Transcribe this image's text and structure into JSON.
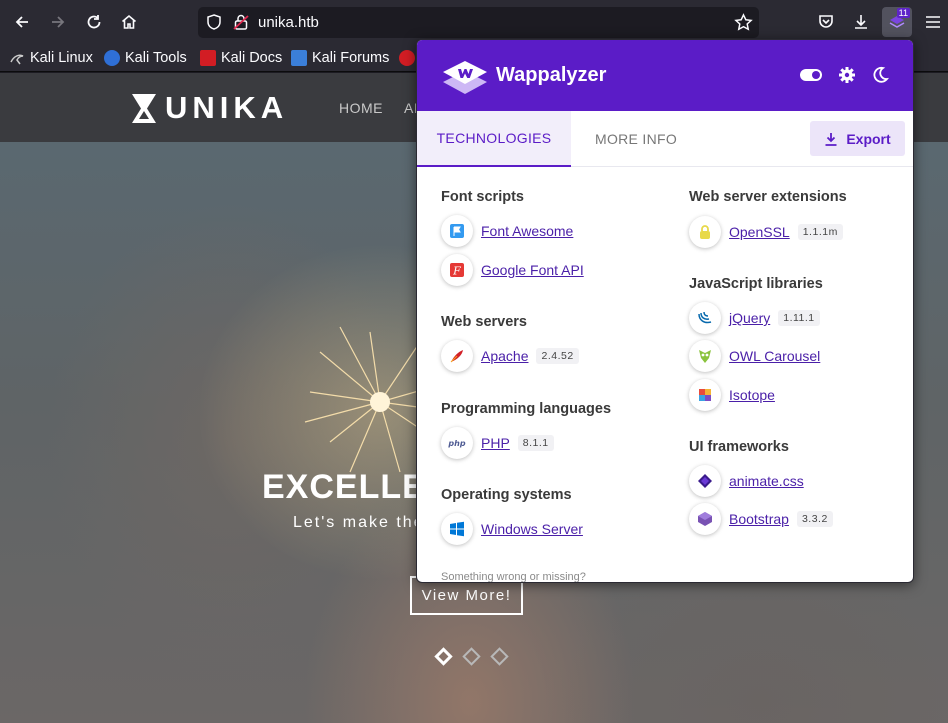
{
  "browser": {
    "url": "unika.htb",
    "extension_badge": "11",
    "bookmarks": [
      "Kali Linux",
      "Kali Tools",
      "Kali Docs",
      "Kali Forums"
    ]
  },
  "site": {
    "logo": "UNIKA",
    "nav": [
      "HOME",
      "AI"
    ],
    "hero_title": "EXCELLEN",
    "hero_subtitle": "Let's make the",
    "hero_button": "View More!"
  },
  "wappalyzer": {
    "brand": "Wappalyzer",
    "tabs": [
      "TECHNOLOGIES",
      "MORE INFO"
    ],
    "export_label": "Export",
    "footer": "Something wrong or missing?",
    "left_categories": [
      {
        "name": "Font scripts",
        "items": [
          {
            "name": "Font Awesome",
            "version": "",
            "icon": "font-awesome-icon"
          },
          {
            "name": "Google Font API",
            "version": "",
            "icon": "google-font-icon"
          }
        ]
      },
      {
        "name": "Web servers",
        "items": [
          {
            "name": "Apache",
            "version": "2.4.52",
            "icon": "apache-feather-icon"
          }
        ]
      },
      {
        "name": "Programming languages",
        "items": [
          {
            "name": "PHP",
            "version": "8.1.1",
            "icon": "php-icon"
          }
        ]
      },
      {
        "name": "Operating systems",
        "items": [
          {
            "name": "Windows Server",
            "version": "",
            "icon": "windows-icon"
          }
        ]
      }
    ],
    "right_categories": [
      {
        "name": "Web server extensions",
        "items": [
          {
            "name": "OpenSSL",
            "version": "1.1.1m",
            "icon": "openssl-lock-icon"
          }
        ]
      },
      {
        "name": "JavaScript libraries",
        "items": [
          {
            "name": "jQuery",
            "version": "1.11.1",
            "icon": "jquery-icon"
          },
          {
            "name": "OWL Carousel",
            "version": "",
            "icon": "owl-icon"
          },
          {
            "name": "Isotope",
            "version": "",
            "icon": "isotope-icon"
          }
        ]
      },
      {
        "name": "UI frameworks",
        "items": [
          {
            "name": "animate.css",
            "version": "",
            "icon": "animate-css-icon"
          },
          {
            "name": "Bootstrap",
            "version": "3.3.2",
            "icon": "bootstrap-icon"
          }
        ]
      }
    ]
  }
}
